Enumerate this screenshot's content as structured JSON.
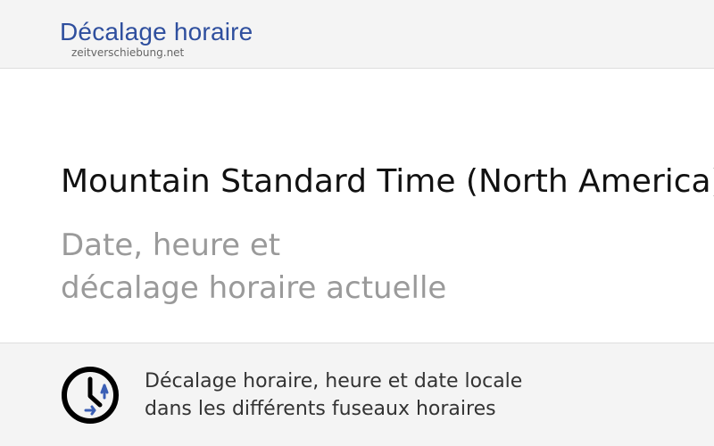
{
  "header": {
    "title": "Décalage horaire",
    "domain": "zeitverschiebung.net"
  },
  "hero": {
    "title": "Mountain Standard Time (North America)",
    "subtitle_line1": "Date, heure et",
    "subtitle_line2": "décalage horaire actuelle"
  },
  "footer": {
    "icon": "clock-icon",
    "text_line1": "Décalage horaire, heure et date locale",
    "text_line2": "dans les différents fuseaux horaires"
  },
  "colors": {
    "brand": "#2f4f9e",
    "clock_arrows": "#3b5fb5",
    "header_bg": "#f4f4f4",
    "subtitle": "#9a9a9a"
  }
}
